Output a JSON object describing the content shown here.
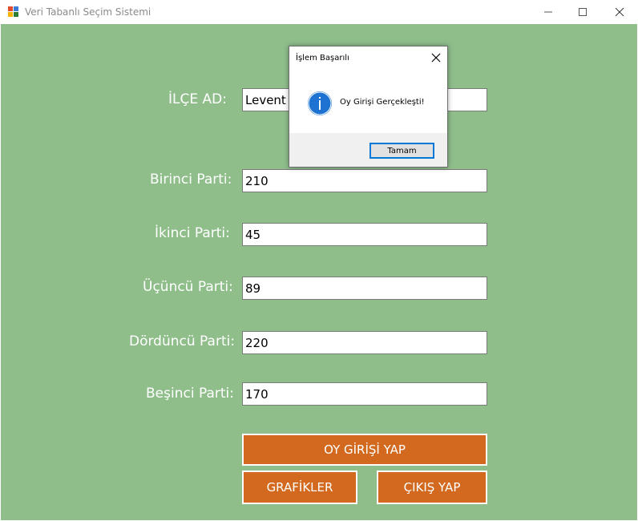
{
  "window": {
    "title": "Veri Tabanlı Seçim Sistemi",
    "icon": "windows-forms-app-icon",
    "controls": {
      "minimize": "minimize-icon",
      "maximize": "maximize-icon",
      "close": "close-icon"
    }
  },
  "form": {
    "background_color": "#8fbe8b",
    "district": {
      "label": "İLÇE AD:",
      "value": "Levent"
    },
    "parties": [
      {
        "label": "Birinci Parti:",
        "value": "210"
      },
      {
        "label": "İkinci Parti:",
        "value": "45"
      },
      {
        "label": "Üçüncü Parti:",
        "value": "89"
      },
      {
        "label": "Dördüncü Parti:",
        "value": "220"
      },
      {
        "label": "Beşinci Parti:",
        "value": "170"
      }
    ],
    "buttons": {
      "submit_vote": "OY GİRİŞİ YAP",
      "charts": "GRAFİKLER",
      "exit": "ÇIKIŞ YAP",
      "color": "#d2691e"
    }
  },
  "dialog": {
    "title": "İşlem Başarılı",
    "icon": "info-icon",
    "message": "Oy Girişi Gerçekleşti!",
    "ok_label": "Tamam",
    "accent_color": "#0078d7"
  }
}
